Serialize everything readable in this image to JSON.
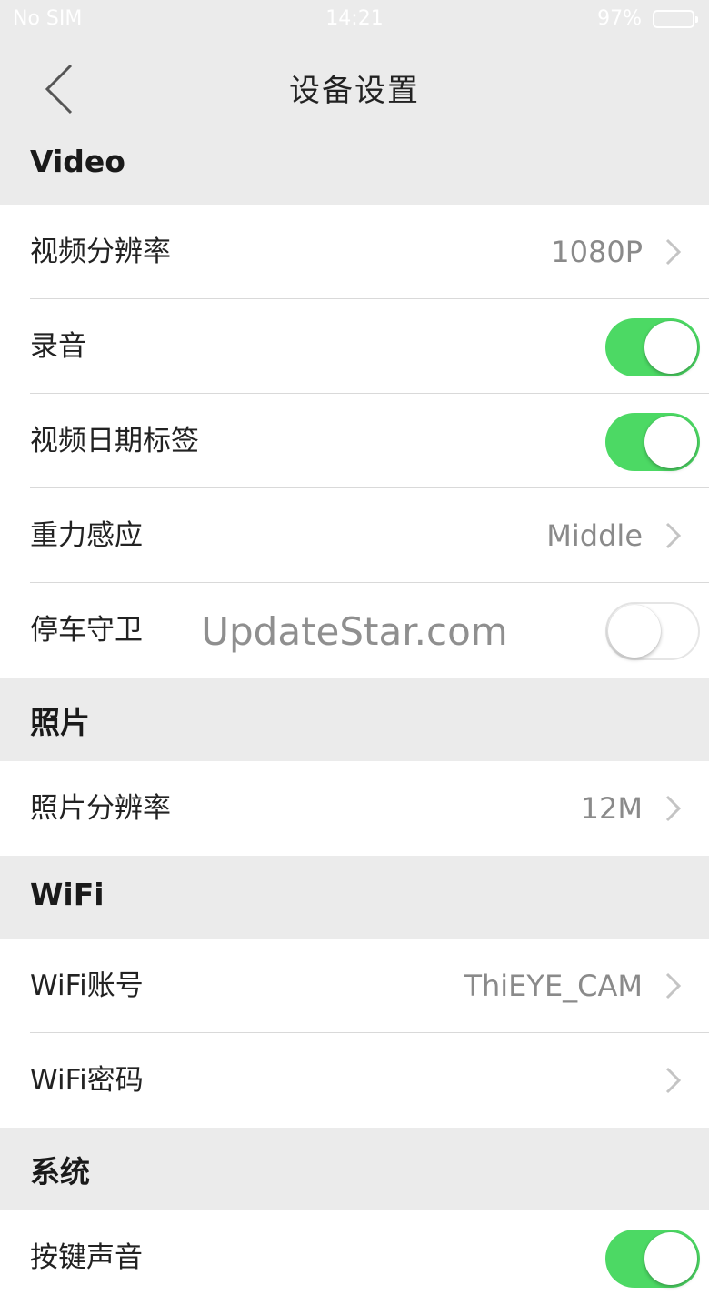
{
  "status_bar": {
    "carrier": "No SIM",
    "time": "14:21",
    "battery": "97%"
  },
  "nav": {
    "title": "设备设置",
    "back_icon": "chevron-left-icon"
  },
  "sections": {
    "video": {
      "header": "Video",
      "resolution": {
        "label": "视频分辨率",
        "value": "1080P"
      },
      "audio": {
        "label": "录音",
        "on": true
      },
      "date_stamp": {
        "label": "视频日期标签",
        "on": true
      },
      "gsensor": {
        "label": "重力感应",
        "value": "Middle"
      },
      "parking": {
        "label": "停车守卫",
        "on": false
      }
    },
    "photo": {
      "header": "照片",
      "resolution": {
        "label": "照片分辨率",
        "value": "12M"
      }
    },
    "wifi": {
      "header": "WiFi",
      "ssid": {
        "label": "WiFi账号",
        "value": "ThiEYE_CAM"
      },
      "password": {
        "label": "WiFi密码"
      }
    },
    "system": {
      "header": "系统",
      "key_sound": {
        "label": "按键声音",
        "on": true
      }
    }
  },
  "watermark": "UpdateStar.com",
  "colors": {
    "toggle_on": "#4cd964",
    "background": "#ebebeb",
    "value_text": "#8a8a8a"
  }
}
